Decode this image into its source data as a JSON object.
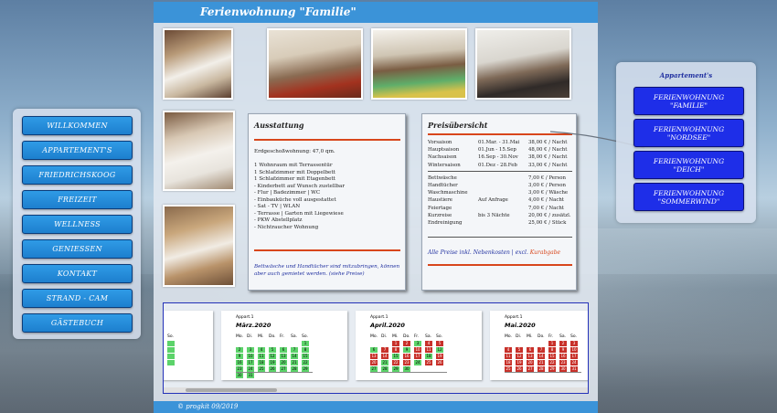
{
  "header": {
    "title": "Ferienwohnung \"Familie\""
  },
  "left_nav": [
    "WILLKOMMEN",
    "APPARTEMENT'S",
    "FRIEDRICHSKOOG",
    "FREIZEIT",
    "WELLNESS",
    "GENIESSEN",
    "KONTAKT",
    "STRAND - CAM",
    "GÄSTEBUCH"
  ],
  "equipment": {
    "title": "Ausstattung",
    "size": "Erdgeschoßwohnung: 47,0 qm.",
    "items": [
      "1 Wohnraum mit Terrassentür",
      "1 Schlafzimmer mit Doppelbett",
      "1 Schlafzimmer mit Etagenbett",
      "- Kinderbett auf Wunsch zustellbar",
      "- Flur | Badezimmer | WC",
      "- Einbauküche voll ausgestattet",
      "- Sat - TV | WLAN",
      "- Terrasse | Garten mit Liegewiese",
      "- PKW Abstellplatz",
      "- Nichtraucher Wohnung"
    ],
    "note": "Bettwäsche und Handtücher sind mitzubringen, können aber auch gemietet werden. (siehe Preise)"
  },
  "prices": {
    "title": "Preisübersicht",
    "seasons": [
      [
        "Vorsaison",
        "01.Mar. - 31.Mai",
        "38,00 € / Nacht"
      ],
      [
        "Hauptsaison",
        "01.Jun - 15.Sep",
        "48,00 € / Nacht"
      ],
      [
        "Nachsaison",
        "16.Sep - 30.Nov",
        "38,00 € / Nacht"
      ],
      [
        "Wintersaison",
        "01.Dez - 28.Feb",
        "33,00 € / Nacht"
      ]
    ],
    "extras": [
      [
        "Bettwäsche",
        "",
        "7,00 € / Person"
      ],
      [
        "Handtücher",
        "",
        "3,00 € / Person"
      ],
      [
        "Waschmaschine",
        "",
        "3,00 € / Wäsche"
      ],
      [
        "Haustiere",
        "Auf Anfrage",
        "4,00 € / Nacht"
      ],
      [
        "Feiertage",
        "",
        "7,00 € / Nacht"
      ],
      [
        "Kurzreise",
        "bis 3 Nächte",
        "20,00 € / zusätzl."
      ],
      [
        "Endreinigung",
        "",
        "25,00 € / Stück"
      ]
    ],
    "footer_main": "Alle Preise inkl. Nebenkosten | excl.",
    "footer_red": "Kurabgabe"
  },
  "calendar": {
    "weekdays": [
      "Mo.",
      "Di.",
      "Mi.",
      "Do.",
      "Fr.",
      "Sa.",
      "So."
    ],
    "months": [
      {
        "app": "Appart.1",
        "name": "März.2020"
      },
      {
        "app": "Appart.1",
        "name": "April.2020"
      },
      {
        "app": "Appart.1",
        "name": "Mai.2020"
      }
    ]
  },
  "footer": {
    "text": "© progkit 09/2019"
  },
  "right_panel": {
    "title": "Appartement's",
    "buttons": [
      [
        "FERIENWOHNUNG",
        "\"FAMILIE\""
      ],
      [
        "FERIENWOHNUNG",
        "\"NORDSEE\""
      ],
      [
        "FERIENWOHNUNG",
        "\"DEICH\""
      ],
      [
        "FERIENWOHNUNG",
        "\"SOMMERWIND\""
      ]
    ]
  }
}
